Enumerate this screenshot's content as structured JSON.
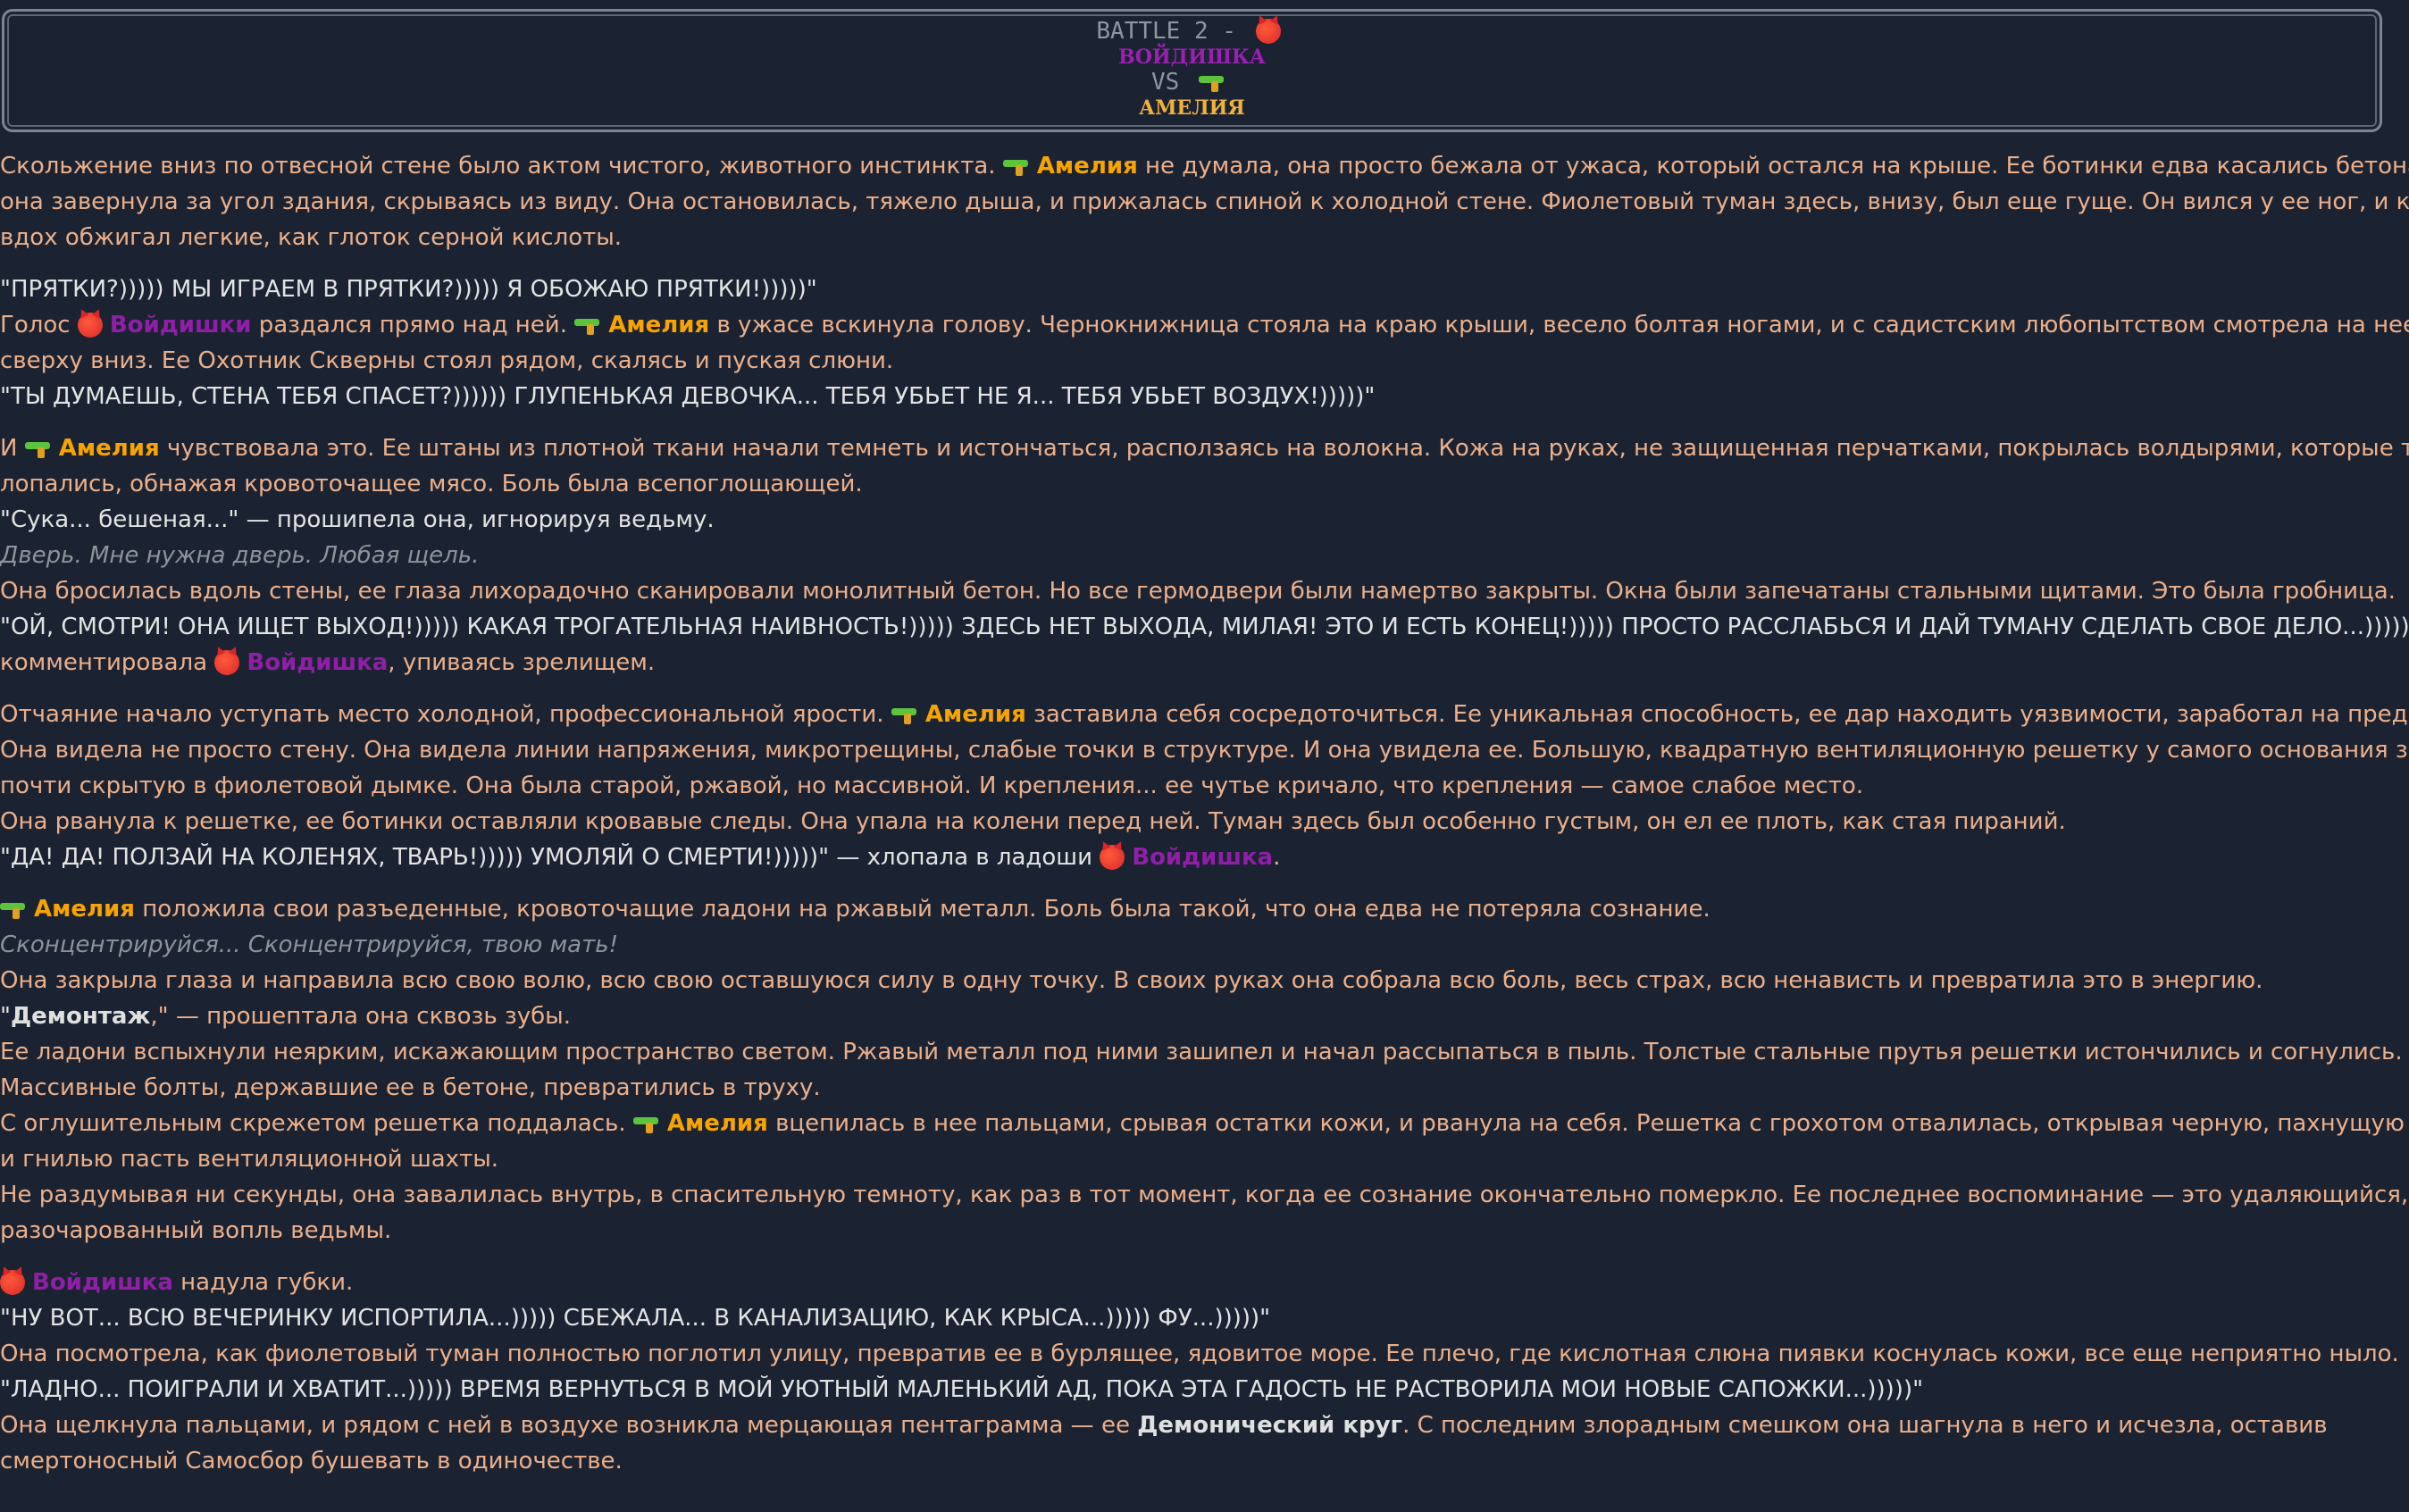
{
  "header": {
    "battle": "BATTLE 2 -",
    "villain": "ВОЙДИШКА",
    "vs": "VS",
    "hero": "АМЕЛИЯ"
  },
  "names": {
    "amelia": "Амелия",
    "voidishki": "Войдишки",
    "voidishka": "Войдишка"
  },
  "icons": [
    "devil-icon",
    "water-gun-icon"
  ],
  "colors": {
    "background": "#1b2332",
    "narration": "#ecaf8a",
    "amelia": "#f7a400",
    "voidishka": "#8e1fa6",
    "thought": "#8f9299"
  },
  "story": {
    "p1": {
      "a1": "Скольжение вниз по отвесной стене было актом чистого, животного инстинкта. ",
      "a2": " не думала, она просто бежала от ужаса, который остался на крыше. Ее ботинки едва касались бетона, когда",
      "b": "она завернула за угол здания, скрываясь из виду. Она остановилась, тяжело дыша, и прижалась спиной к холодной стене. Фиолетовый туман здесь, внизу, был еще гуще. Он вился у ее ног, и каждый",
      "c": "вдох обжигал легкие, как глоток серной кислоты."
    },
    "p2": {
      "q1": "\"ПРЯТКИ?))))) МЫ ИГРАЕМ В ПРЯТКИ?))))) Я ОБОЖАЮ ПРЯТКИ!)))))\"",
      "b1": "Голос ",
      "b2": " раздался прямо над ней. ",
      "b3": " в ужасе вскинула голову. Чернокнижница стояла на краю крыши, весело болтая ногами, и с садистским любопытством смотрела на нее",
      "c": "сверху вниз. Ее Охотник Скверны стоял рядом, скалясь и пуская слюни.",
      "q2": "\"ТЫ ДУМАЕШЬ, СТЕНА ТЕБЯ СПАСЕТ?)))))) ГЛУПЕНЬКАЯ ДЕВОЧКА... ТЕБЯ УБЬЕТ НЕ Я... ТЕБЯ УБЬЕТ ВОЗДУХ!)))))\""
    },
    "p3": {
      "a1": "И ",
      "a2": " чувствовала это. Ее штаны из плотной ткани начали темнеть и истончаться, расползаясь на волокна. Кожа на руках, не защищенная перчатками, покрылась волдырями, которые тут же",
      "b": "лопались, обнажая кровоточащее мясо. Боль была всепоглощающей.",
      "c": "\"Сука... бешеная...\" — прошипела она, игнорируя ведьму.",
      "t": "Дверь. Мне нужна дверь. Любая щель.",
      "d": "Она бросилась вдоль стены, ее глаза лихорадочно сканировали монолитный бетон. Но все гермодвери были намертво закрыты. Окна были запечатаны стальными щитами. Это была гробница.",
      "q": "\"ОЙ, СМОТРИ! ОНА ИЩЕТ ВЫХОД!))))) КАКАЯ ТРОГАТЕЛЬНАЯ НАИВНОСТЬ!))))) ЗДЕСЬ НЕТ ВЫХОДА, МИЛАЯ! ЭТО И ЕСТЬ КОНЕЦ!))))) ПРОСТО РАССЛАБЬСЯ И ДАЙ ТУМАНУ СДЕЛАТЬ СВОЕ ДЕЛО...)))))\" —",
      "e1": "комментировала ",
      "e2": ", упиваясь зрелищем."
    },
    "p4": {
      "a1": "Отчаяние начало уступать место холодной, профессиональной ярости. ",
      "a2": " заставила себя сосредоточиться. Ее уникальная способность, ее дар находить уязвимости, заработал на пределе.",
      "b": "Она видела не просто стену. Она видела линии напряжения, микротрещины, слабые точки в структуре. И она увидела ее. Большую, квадратную вентиляционную решетку у самого основания здания,",
      "c": "почти скрытую в фиолетовой дымке. Она была старой, ржавой, но массивной. И крепления... ее чутье кричало, что крепления — самое слабое место.",
      "d": "Она рванула к решетке, ее ботинки оставляли кровавые следы. Она упала на колени перед ней. Туман здесь был особенно густым, он ел ее плоть, как стая пираний.",
      "e1": "\"ДА! ДА! ПОЛЗАЙ НА КОЛЕНЯХ, ТВАРЬ!))))) УМОЛЯЙ О СМЕРТИ!)))))\" — хлопала в ладоши ",
      "e2": "."
    },
    "p5": {
      "a2": " положила свои разъеденные, кровоточащие ладони на ржавый металл. Боль была такой, что она едва не потеряла сознание.",
      "t": "Сконцентрируйся... Сконцентрируйся, твою мать!",
      "b": "Она закрыла глаза и направила всю свою волю, всю свою оставшуюся силу в одну точку. В своих руках она собрала всю боль, весь страх, всю ненависть и превратила это в энергию.",
      "c1": "\"",
      "c2": "Демонтаж",
      "c3": ",\" — прошептала она сквозь зубы.",
      "d": "Ее ладони вспыхнули неярким, искажающим пространство светом. Ржавый металл под ними зашипел и начал рассыпаться в пыль. Толстые стальные прутья решетки истончились и согнулись.",
      "e": "Массивные болты, державшие ее в бетоне, превратились в труху.",
      "f1": "С оглушительным скрежетом решетка поддалась. ",
      "f2": " вцепилась в нее пальцами, срывая остатки кожи, и рванула на себя. Решетка с грохотом отвалилась, открывая черную, пахнущую пылью",
      "g": "и гнилью пасть вентиляционной шахты.",
      "h": "Не раздумывая ни секунды, она завалилась внутрь, в спасительную темноту, как раз в тот момент, когда ее сознание окончательно померкло. Ее последнее воспоминание — это удаляющийся,",
      "i": "разочарованный вопль ведьмы."
    },
    "p6": {
      "a2": " надула губки.",
      "q1": "\"НУ ВОТ... ВСЮ ВЕЧЕРИНКУ ИСПОРТИЛА...))))) СБЕЖАЛА... В КАНАЛИЗАЦИЮ, КАК КРЫСА...))))) ФУ...)))))\"",
      "b": "Она посмотрела, как фиолетовый туман полностью поглотил улицу, превратив ее в бурлящее, ядовитое море. Ее плечо, где кислотная слюна пиявки коснулась кожи, все еще неприятно ныло.",
      "q2": "\"ЛАДНО... ПОИГРАЛИ И ХВАТИТ...))))) ВРЕМЯ ВЕРНУТЬСЯ В МОЙ УЮТНЫЙ МАЛЕНЬКИЙ АД, ПОКА ЭТА ГАДОСТЬ НЕ РАСТВОРИЛА МОИ НОВЫЕ САПОЖКИ...)))))\"",
      "c1": "Она щелкнула пальцами, и рядом с ней в воздухе возникла мерцающая пентаграмма — ее ",
      "c2": "Демонический круг",
      "c3": ". С последним злорадным смешком она шагнула в него и исчезла, оставив",
      "d": "смертоносный Самосбор бушевать в одиночестве."
    }
  }
}
